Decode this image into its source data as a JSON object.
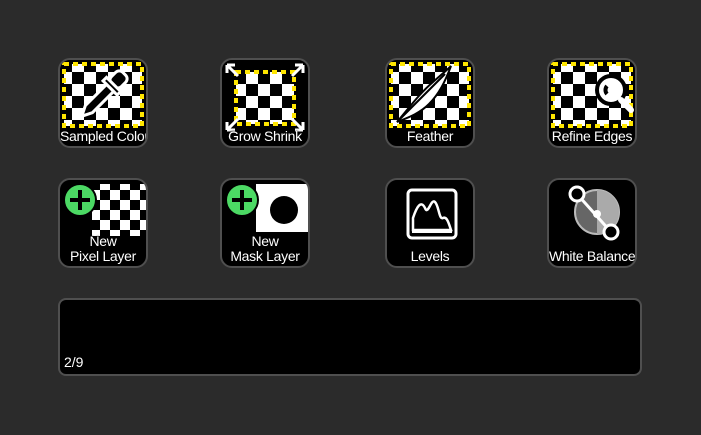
{
  "keys": [
    {
      "label": "Sampled Color",
      "icon": "eyedropper-icon"
    },
    {
      "label": "Grow Shrink",
      "icon": "grow-shrink-icon"
    },
    {
      "label": "Feather",
      "icon": "feather-icon"
    },
    {
      "label": "Refine Edges",
      "icon": "magnifier-icon"
    },
    {
      "label_line1": "New",
      "label_line2": "Pixel Layer",
      "icon": "add-icon"
    },
    {
      "label_line1": "New",
      "label_line2": "Mask Layer",
      "icon": "add-icon"
    },
    {
      "label": "Levels",
      "icon": "levels-histogram-icon"
    },
    {
      "label": "White Balance",
      "icon": "white-balance-icon"
    }
  ],
  "info_bar": {
    "page": "2/9"
  },
  "colors": {
    "background": "#2b2b2b",
    "key_bg": "#000000",
    "key_border": "#4f4f4f",
    "selection_dash": "#ffe600",
    "add_green": "#4cd964"
  }
}
